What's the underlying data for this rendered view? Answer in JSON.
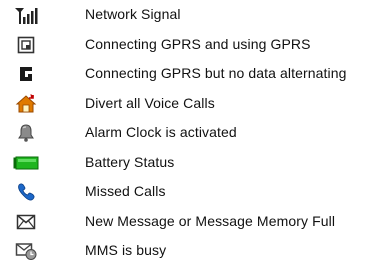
{
  "legend": {
    "items": [
      {
        "icon": "signal-strength-icon",
        "label": "Network Signal"
      },
      {
        "icon": "gprs-active-icon",
        "label": "Connecting GPRS and using GPRS"
      },
      {
        "icon": "gprs-idle-icon",
        "label": "Connecting GPRS but no data alternating"
      },
      {
        "icon": "call-divert-icon",
        "label": "Divert all Voice Calls"
      },
      {
        "icon": "alarm-bell-icon",
        "label": "Alarm Clock is activated"
      },
      {
        "icon": "battery-icon",
        "label": "Battery Status"
      },
      {
        "icon": "missed-call-icon",
        "label": "Missed Calls"
      },
      {
        "icon": "envelope-icon",
        "label": "New Message or Message Memory Full"
      },
      {
        "icon": "mms-busy-icon",
        "label": "MMS is busy"
      }
    ]
  },
  "colors": {
    "text": "#111111",
    "battery_fill": "#1fb51f",
    "divert_house": "#e07a00",
    "missed_call": "#1c67c8",
    "icon_dark": "#333333"
  }
}
